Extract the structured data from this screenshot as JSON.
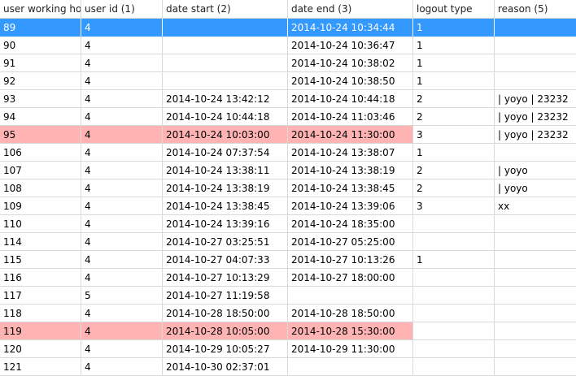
{
  "columns": [
    "user working ho",
    "user id (1)",
    "date start (2)",
    "date end (3)",
    "logout type",
    "reason (5)"
  ],
  "rows": [
    {
      "id": "89",
      "user": "4",
      "start": "",
      "end": "2014-10-24 10:34:44",
      "logout": "1",
      "reason": ""
    },
    {
      "id": "90",
      "user": "4",
      "start": "",
      "end": "2014-10-24 10:36:47",
      "logout": "1",
      "reason": ""
    },
    {
      "id": "91",
      "user": "4",
      "start": "",
      "end": "2014-10-24 10:38:02",
      "logout": "1",
      "reason": ""
    },
    {
      "id": "92",
      "user": "4",
      "start": "",
      "end": "2014-10-24 10:38:50",
      "logout": "1",
      "reason": ""
    },
    {
      "id": "93",
      "user": "4",
      "start": "2014-10-24 13:42:12",
      "end": "2014-10-24 10:44:18",
      "logout": "2",
      "reason": "| yoyo | 23232"
    },
    {
      "id": "94",
      "user": "4",
      "start": "2014-10-24 10:44:18",
      "end": "2014-10-24 11:03:46",
      "logout": "2",
      "reason": "| yoyo | 23232"
    },
    {
      "id": "95",
      "user": "4",
      "start": "2014-10-24 10:03:00",
      "end": "2014-10-24 11:30:00",
      "logout": "3",
      "reason": "| yoyo | 23232"
    },
    {
      "id": "106",
      "user": "4",
      "start": "2014-10-24 07:37:54",
      "end": "2014-10-24 13:38:07",
      "logout": "1",
      "reason": ""
    },
    {
      "id": "107",
      "user": "4",
      "start": "2014-10-24 13:38:11",
      "end": "2014-10-24 13:38:19",
      "logout": "2",
      "reason": "| yoyo"
    },
    {
      "id": "108",
      "user": "4",
      "start": "2014-10-24 13:38:19",
      "end": "2014-10-24 13:38:45",
      "logout": "2",
      "reason": "| yoyo"
    },
    {
      "id": "109",
      "user": "4",
      "start": "2014-10-24 13:38:45",
      "end": "2014-10-24 13:39:06",
      "logout": "3",
      "reason": "xx"
    },
    {
      "id": "110",
      "user": "4",
      "start": "2014-10-24 13:39:16",
      "end": "2014-10-24 18:35:00",
      "logout": "",
      "reason": ""
    },
    {
      "id": "114",
      "user": "4",
      "start": "2014-10-27 03:25:51",
      "end": "2014-10-27 05:25:00",
      "logout": "",
      "reason": ""
    },
    {
      "id": "115",
      "user": "4",
      "start": "2014-10-27 04:07:33",
      "end": "2014-10-27 10:13:26",
      "logout": "1",
      "reason": ""
    },
    {
      "id": "116",
      "user": "4",
      "start": "2014-10-27 10:13:29",
      "end": "2014-10-27 18:00:00",
      "logout": "",
      "reason": ""
    },
    {
      "id": "117",
      "user": "5",
      "start": "2014-10-27 11:19:58",
      "end": "",
      "logout": "",
      "reason": ""
    },
    {
      "id": "118",
      "user": "4",
      "start": "2014-10-28 18:50:00",
      "end": "2014-10-28 18:50:00",
      "logout": "",
      "reason": ""
    },
    {
      "id": "119",
      "user": "4",
      "start": "2014-10-28 10:05:00",
      "end": "2014-10-28 15:30:00",
      "logout": "",
      "reason": ""
    },
    {
      "id": "120",
      "user": "4",
      "start": "2014-10-29 10:05:27",
      "end": "2014-10-29 11:30:00",
      "logout": "",
      "reason": ""
    },
    {
      "id": "121",
      "user": "4",
      "start": "2014-10-30 02:37:01",
      "end": "",
      "logout": "",
      "reason": ""
    }
  ],
  "selected_row_index": 0,
  "highlight_color": "#ffb3b3",
  "selection_color": "#3399ff"
}
